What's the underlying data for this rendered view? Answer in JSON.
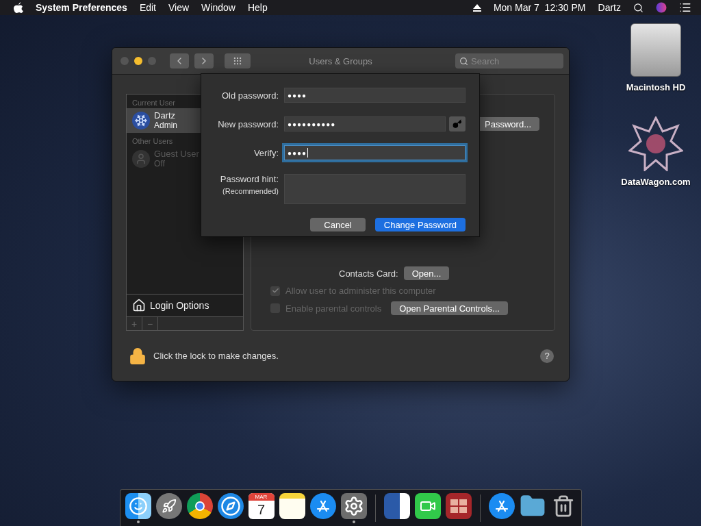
{
  "menu_bar": {
    "items": [
      {
        "label": "System Preferences",
        "kind": "app"
      },
      {
        "label": "Edit",
        "kind": "menu"
      },
      {
        "label": "View",
        "kind": "menu"
      },
      {
        "label": "Window",
        "kind": "menu"
      },
      {
        "label": "Help",
        "kind": "menu"
      }
    ],
    "clock": "Mon Mar 7  12:30 PM",
    "user": "Dartz"
  },
  "desktop_icons": [
    {
      "label": "Macintosh HD",
      "kind": "drive"
    },
    {
      "label": "DataWagon.com",
      "kind": "star"
    }
  ],
  "window": {
    "title": "Users & Groups",
    "search": {
      "placeholder": "Search"
    },
    "user_groups": [
      {
        "heading": "Current User",
        "users": [
          {
            "name": "Dartz",
            "role": "Admin",
            "selected": true,
            "disabled": false,
            "kind": "snowflake"
          }
        ]
      },
      {
        "heading": "Other Users",
        "users": [
          {
            "name": "Guest User",
            "role": "Off",
            "selected": false,
            "disabled": true,
            "kind": "guest"
          }
        ]
      }
    ],
    "login_options": "Login Options",
    "add": "+",
    "remove": "−",
    "password_button": "Password...",
    "contacts_label": "Contacts Card:",
    "open_button": "Open...",
    "checkboxes": [
      {
        "label": "Allow user to administer this computer",
        "checked": true,
        "disabled": true
      },
      {
        "label": "Enable parental controls",
        "checked": false,
        "disabled": true
      }
    ],
    "parental_button": "Open Parental Controls...",
    "lock_text": "Click the lock to make changes.",
    "help": "?"
  },
  "sheet": {
    "fields": [
      {
        "label": "Old password:",
        "value": "●●●●",
        "focused": false,
        "kind": "plain"
      },
      {
        "label": "New password:",
        "value": "●●●●●●●●●●",
        "focused": false,
        "kind": "keyed"
      },
      {
        "label": "Verify:",
        "value": "●●●●",
        "focused": true,
        "kind": "plain"
      }
    ],
    "hint_label": "Password hint:",
    "hint_sub": "(Recommended)",
    "buttons": [
      {
        "label": "Cancel",
        "default": false
      },
      {
        "label": "Change Password",
        "default": true
      }
    ]
  },
  "dock": [
    {
      "kind": "finder",
      "running": true
    },
    {
      "kind": "launchpad",
      "running": false
    },
    {
      "kind": "chrome",
      "running": false
    },
    {
      "kind": "safari",
      "running": false
    },
    {
      "kind": "calendar",
      "running": false,
      "month": "MAR",
      "day": "7"
    },
    {
      "kind": "notes",
      "running": false
    },
    {
      "kind": "appstore",
      "running": false
    },
    {
      "kind": "settings",
      "running": true
    },
    {
      "kind": "separator"
    },
    {
      "kind": "word",
      "running": false
    },
    {
      "kind": "facetime",
      "running": false
    },
    {
      "kind": "photobooth",
      "running": false
    },
    {
      "kind": "separator"
    },
    {
      "kind": "appstore",
      "running": false
    },
    {
      "kind": "folder",
      "running": false
    },
    {
      "kind": "trash",
      "running": false
    }
  ]
}
